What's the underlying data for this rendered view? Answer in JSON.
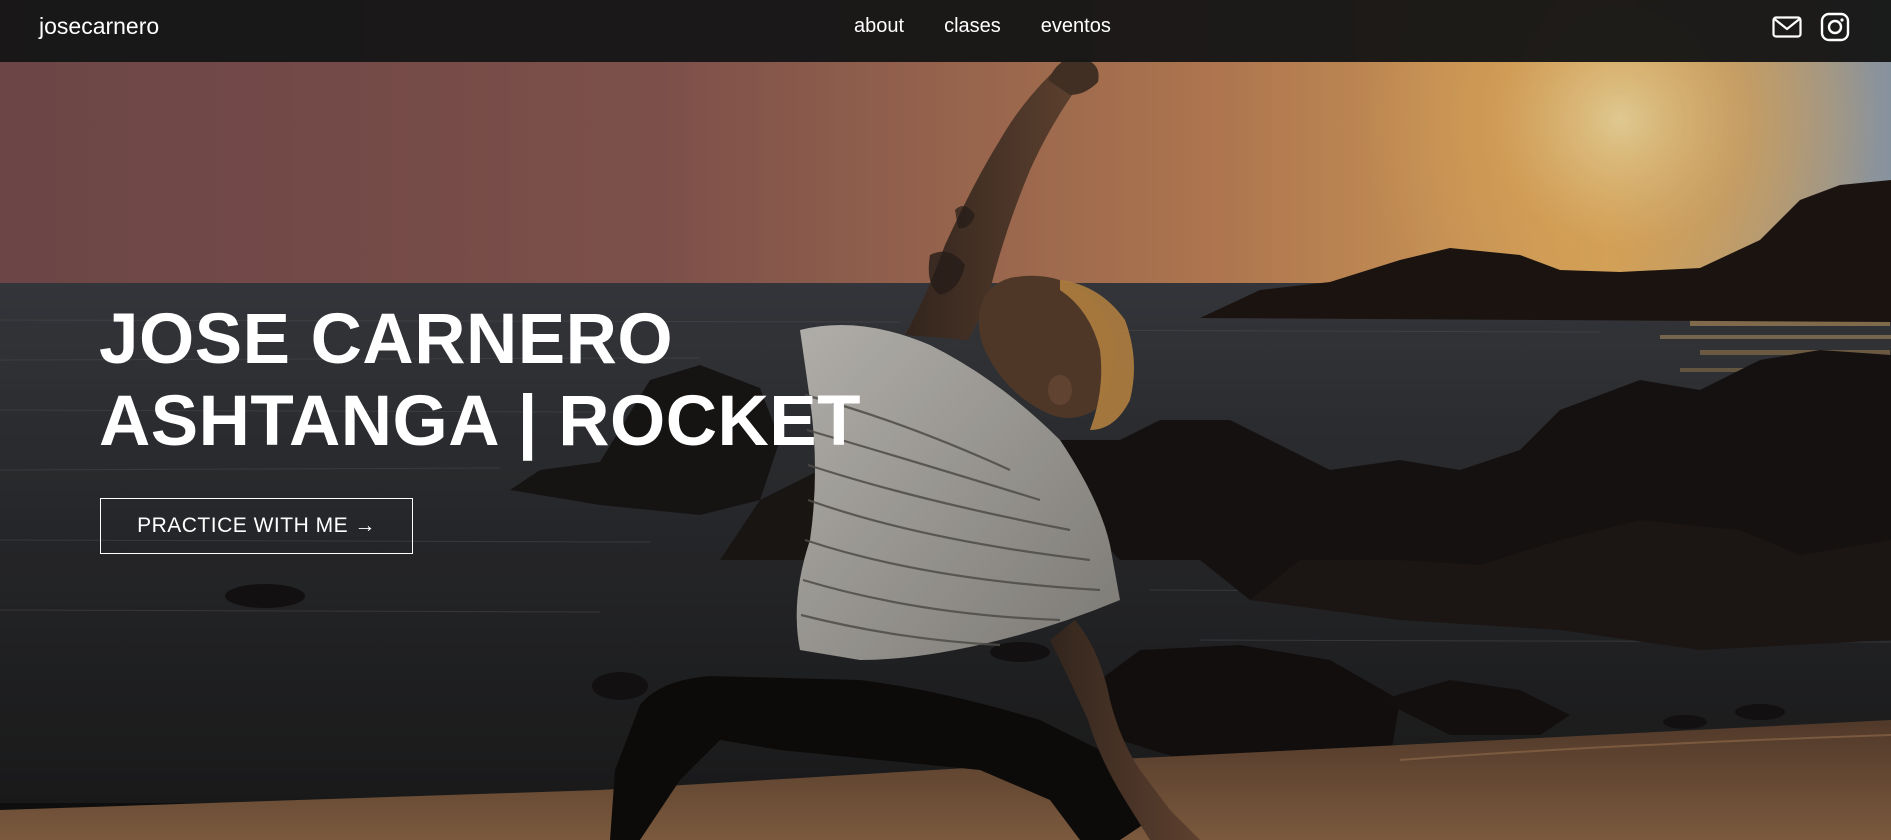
{
  "nav": {
    "logo": "josecarnero",
    "links": [
      "about",
      "clases",
      "eventos"
    ],
    "icons": [
      "mail-icon",
      "instagram-icon"
    ]
  },
  "hero": {
    "title_line1": "JOSE CARNERO",
    "title_line2": "ASHTANGA | ROCKET",
    "cta_label": "PRACTICE WITH ME →",
    "image": "yoga-practitioner-side-stretch-on-beach-at-sunset"
  },
  "colors": {
    "nav_bg": "#161616",
    "text": "#ffffff",
    "sky_top": "#8a5a58",
    "sun": "#f1bd68",
    "sea": "#2f2f30",
    "sand": "#8a6545"
  }
}
